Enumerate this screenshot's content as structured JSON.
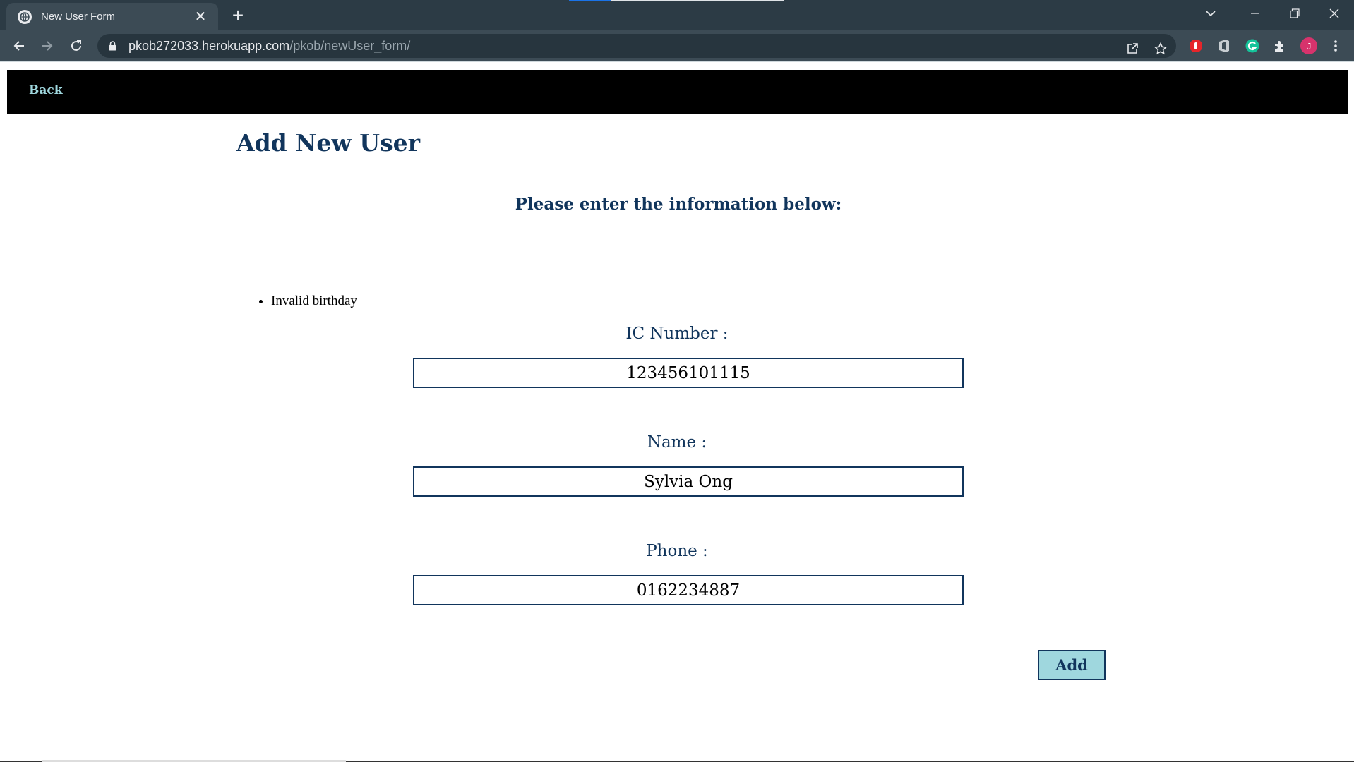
{
  "browser": {
    "tab_title": "New User Form",
    "tab_close": "✕",
    "new_tab": "+",
    "url_host": "pkob272033.herokuapp.com",
    "url_path": "/pkob/newUser_form/",
    "profile_initial": "J"
  },
  "page": {
    "nav": {
      "back_label": "Back"
    },
    "title": "Add New User",
    "subtitle": "Please enter the information below:",
    "errors": [
      "Invalid birthday"
    ],
    "fields": {
      "ic": {
        "label": "IC Number :",
        "value": "123456101115"
      },
      "name": {
        "label": "Name :",
        "value": "Sylvia Ong"
      },
      "phone": {
        "label": "Phone :",
        "value": "0162234887"
      }
    },
    "submit_label": "Add"
  },
  "colors": {
    "navbar_bg": "#000000",
    "accent": "#9fd7de",
    "heading": "#11355c"
  }
}
